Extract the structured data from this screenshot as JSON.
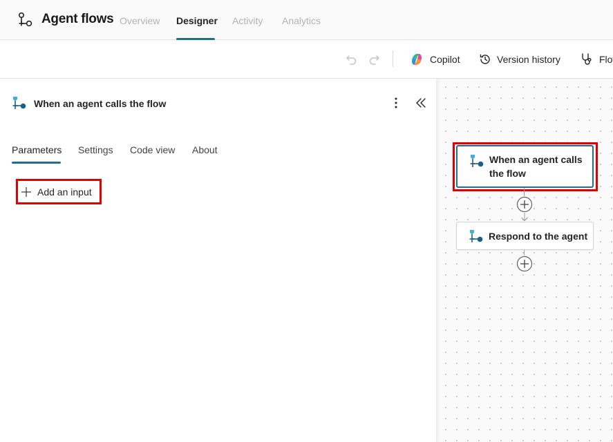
{
  "header": {
    "app_title": "Agent flows",
    "tabs": [
      {
        "label": "Overview",
        "active": false
      },
      {
        "label": "Designer",
        "active": true
      },
      {
        "label": "Activity",
        "active": false
      },
      {
        "label": "Analytics",
        "active": false
      }
    ]
  },
  "toolbar": {
    "undo_icon": "undo-icon",
    "redo_icon": "redo-icon",
    "copilot_label": "Copilot",
    "version_history_label": "Version history",
    "flow_checker_label": "Flow"
  },
  "panel": {
    "title": "When an agent calls the flow",
    "tabs": [
      {
        "label": "Parameters",
        "active": true
      },
      {
        "label": "Settings",
        "active": false
      },
      {
        "label": "Code view",
        "active": false
      },
      {
        "label": "About",
        "active": false
      }
    ],
    "add_input_label": "Add an input"
  },
  "canvas": {
    "nodes": [
      {
        "label": "When an agent calls the flow",
        "selected": true
      },
      {
        "label": "Respond to the agent",
        "selected": false
      }
    ]
  },
  "colors": {
    "accent": "#1f6f8b",
    "highlight": "#e00000",
    "node_icon_light": "#3fb0d9",
    "node_icon_dark": "#1b5e86"
  }
}
